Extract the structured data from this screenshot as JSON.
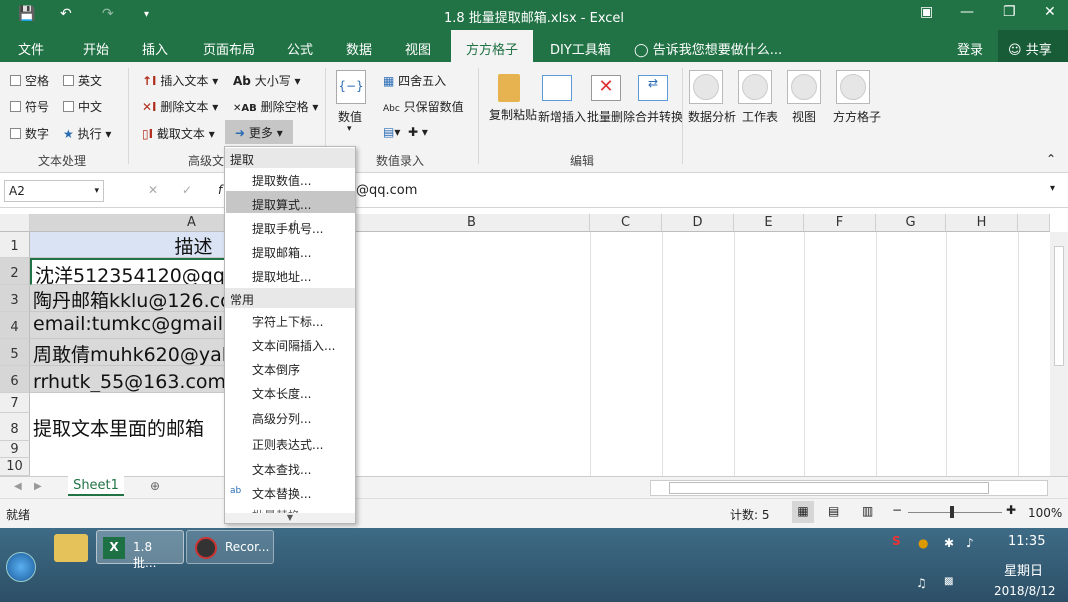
{
  "title": "1.8 批量提取邮箱.xlsx - Excel",
  "tabs": [
    "文件",
    "开始",
    "插入",
    "页面布局",
    "公式",
    "数据",
    "视图",
    "方方格子",
    "DIY工具箱"
  ],
  "active_tab": "方方格子",
  "tell_me": "告诉我您想要做什么...",
  "login": "登录",
  "share": "共享",
  "ribbon": {
    "text_group": {
      "items": [
        "空格",
        "英文",
        "符号",
        "中文",
        "数字",
        "执行"
      ],
      "label": "文本处理"
    },
    "adv_group": {
      "items": [
        "插入文本",
        "删除文本",
        "截取文本",
        "大小写",
        "删除空格",
        "更多"
      ],
      "label": "高级文"
    },
    "num_group": {
      "items": [
        "数值",
        "四舍五入",
        "只保留数值"
      ],
      "label": "数值录入"
    },
    "edit_group": {
      "items": [
        "复制粘贴",
        "新增插入",
        "批量删除",
        "合并转换"
      ],
      "label": "编辑"
    },
    "other": [
      "数据分析",
      "工作表",
      "视图",
      "方方格子"
    ]
  },
  "formula": {
    "namebox": "A2",
    "content": "@qq.com"
  },
  "columns": [
    "A",
    "B",
    "C",
    "D",
    "E",
    "F",
    "G",
    "H"
  ],
  "rows": [
    "1",
    "2",
    "3",
    "4",
    "5",
    "6",
    "7",
    "8",
    "9",
    "10"
  ],
  "cells": {
    "a1": "描述",
    "a2": "沈洋512354120@qq.",
    "a3": "陶丹邮箱kklu@126.co",
    "a4": "email:tumkc@gmail.c",
    "a5": "周敢倩muhk620@yal",
    "a6": "rrhutk_55@163.com阝",
    "a8": "提取文本里面的邮箱"
  },
  "menu": {
    "sections": [
      "提取",
      "常用"
    ],
    "extract": [
      "提取数值...",
      "提取算式...",
      "提取手机号...",
      "提取邮箱...",
      "提取地址..."
    ],
    "common": [
      "字符上下标...",
      "文本间隔插入...",
      "文本倒序",
      "文本长度...",
      "高级分列...",
      "正则表达式...",
      "文本查找...",
      "文本替换...",
      "批量替换..."
    ]
  },
  "sheet_tab": "Sheet1",
  "status": {
    "ready": "就绪",
    "count": "计数: 5",
    "zoom": "100%"
  },
  "taskbar": {
    "excel": "1.8 批...",
    "rec": "Recor...",
    "time": "11:35",
    "weekday": "星期日",
    "date": "2018/8/12"
  }
}
